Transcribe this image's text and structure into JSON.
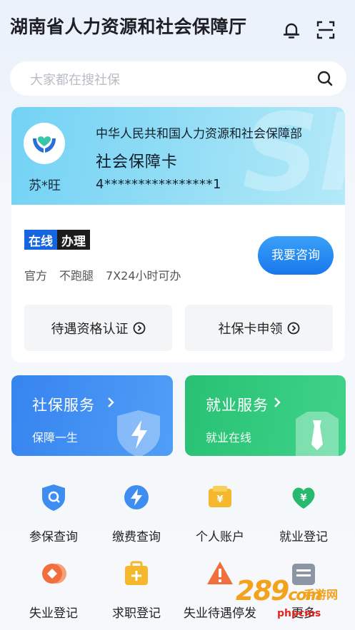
{
  "header": {
    "title": "湖南省人力资源和社会保障厅",
    "icons": [
      "bell-icon",
      "scan-icon"
    ]
  },
  "search": {
    "placeholder": "大家都在搜社保"
  },
  "card": {
    "ministry": "中华人民共和国人力资源和社会保障部",
    "name": "社会保障卡",
    "holder": "苏*旺",
    "number": "4****************1"
  },
  "online": {
    "badge_a": "在线",
    "badge_b": "办理",
    "tags": [
      "官方",
      "不跑腿",
      "7X24小时可办"
    ],
    "consult_label": "我要咨询"
  },
  "actions": [
    {
      "label": "待遇资格认证"
    },
    {
      "label": "社保卡申领"
    }
  ],
  "tiles": [
    {
      "title": "社保服务",
      "subtitle": "保障一生"
    },
    {
      "title": "就业服务",
      "subtitle": "就业在线"
    }
  ],
  "grid": [
    {
      "label": "参保查询",
      "icon": "shield-search-icon"
    },
    {
      "label": "缴费查询",
      "icon": "lightning-icon"
    },
    {
      "label": "个人账户",
      "icon": "wallet-icon"
    },
    {
      "label": "就业登记",
      "icon": "heart-yen-icon"
    },
    {
      "label": "失业登记",
      "icon": "coin-icon"
    },
    {
      "label": "求职登记",
      "icon": "briefcase-plus-icon"
    },
    {
      "label": "失业待遇停发",
      "icon": "warning-icon"
    },
    {
      "label": "更多",
      "icon": "more-icon"
    }
  ],
  "watermark": {
    "num": "289",
    "suffix": "com",
    "cn": "手游网",
    "url": "phpcms"
  },
  "colors": {
    "accent": "#1878ec",
    "green": "#28c173",
    "orange": "#f5a623"
  }
}
